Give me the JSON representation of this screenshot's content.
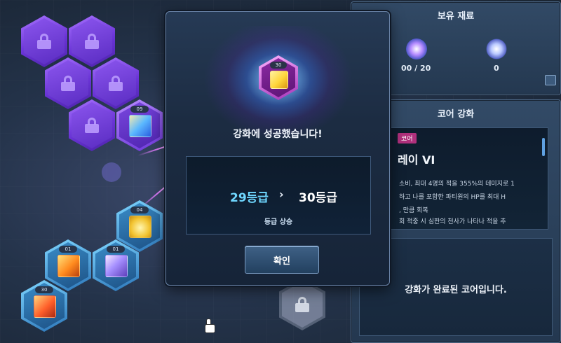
{
  "materials_panel": {
    "title": "보유 재료",
    "count_1": "00 / 20",
    "count_2": "0"
  },
  "core_panel": {
    "title": "코어 강화",
    "tag": "코어",
    "skill_name": "레이 VI",
    "description_lines": [
      "소비, 최대 4명의 적을 355%의 데미지로 1",
      "하고 나를 포함한 파티원의 HP를 최대 H",
      ", 만큼 회복",
      "회 적중 시 심판의 천사가 나타나 적을 추"
    ],
    "completed_message": "강화가 완료된 코어입니다."
  },
  "modal": {
    "core_level": "30",
    "success_message": "강화에 성공했습니다!",
    "grade_from": "29등급",
    "grade_arrow": "›",
    "grade_to": "30등급",
    "grade_up_label": "등급 상승",
    "confirm_label": "확인"
  },
  "core_grid": {
    "levels": [
      "09",
      "04",
      "01",
      "01",
      "30"
    ]
  }
}
